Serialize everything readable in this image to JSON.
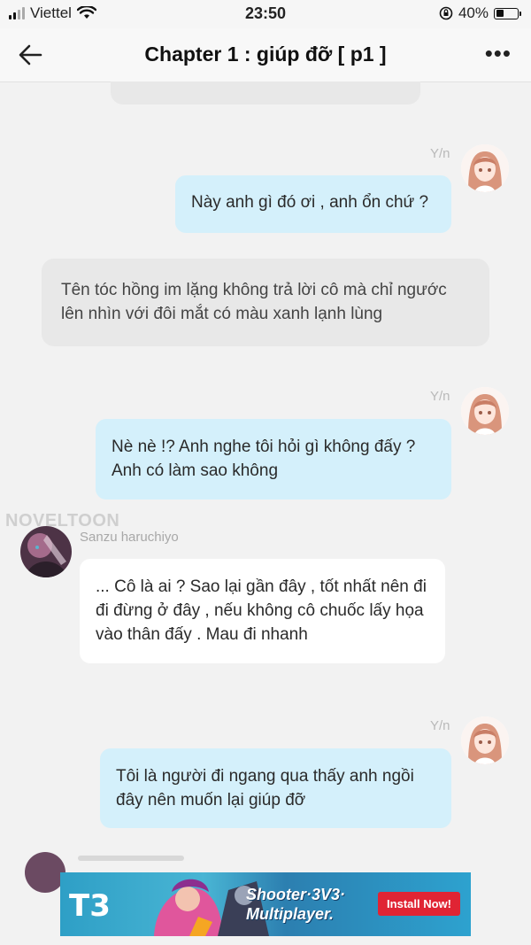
{
  "status": {
    "carrier": "Viettel",
    "time": "23:50",
    "battery": "40%",
    "battery_level": 0.4
  },
  "header": {
    "title": "Chapter 1 : giúp đỡ [ p1 ]"
  },
  "messages": [
    {
      "speaker": "Y/n",
      "text": "Này anh gì đó ơi , anh ổn chứ ?"
    },
    {
      "text": "Tên tóc hồng im lặng không trả lời cô mà chỉ ngước lên nhìn với đôi mắt có màu xanh lạnh lùng"
    },
    {
      "speaker": "Y/n",
      "text": "Nè nè !? Anh nghe tôi hỏi gì không đấy ? Anh có làm sao không"
    },
    {
      "speaker": "Sanzu haruchiyo",
      "text": "... Cô là ai ? Sao lại gần đây , tốt nhất nên đi đi đừng ở đây , nếu không cô chuốc lấy họa vào thân đấy . Mau đi nhanh"
    },
    {
      "speaker": "Y/n",
      "text": "Tôi là người đi ngang qua thấy anh ngồi đây nên muốn lại giúp đỡ"
    }
  ],
  "watermark": "NOVELTOON",
  "ad": {
    "logo": "T3",
    "line1": "Shooter·3V3·",
    "line2": "Multiplayer.",
    "button": "Install Now!"
  }
}
